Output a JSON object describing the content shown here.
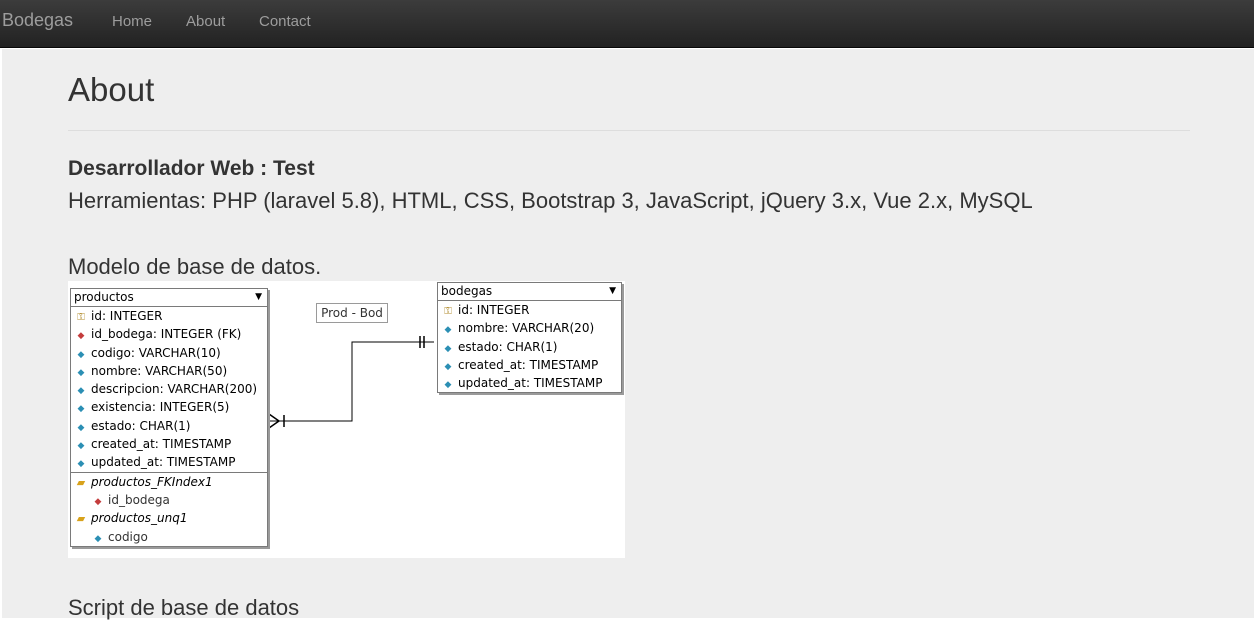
{
  "navbar": {
    "brand": "Bodegas",
    "links": [
      "Home",
      "About",
      "Contact"
    ]
  },
  "page": {
    "title": "About",
    "developer": "Desarrollador Web : Test",
    "tools": "Herramientas: PHP (laravel 5.8), HTML, CSS, Bootstrap 3, JavaScript, jQuery 3.x, Vue 2.x, MySQL",
    "model_heading": "Modelo de base de datos.",
    "script_heading": "Script de base de datos"
  },
  "diagram": {
    "productos": {
      "name": "productos",
      "columns": [
        "id: INTEGER",
        "id_bodega: INTEGER (FK)",
        "codigo: VARCHAR(10)",
        "nombre: VARCHAR(50)",
        "descripcion: VARCHAR(200)",
        "existencia: INTEGER(5)",
        "estado: CHAR(1)",
        "created_at: TIMESTAMP",
        "updated_at: TIMESTAMP"
      ],
      "indexes": [
        {
          "name": "productos_FKIndex1",
          "column": "id_bodega"
        },
        {
          "name": "productos_unq1",
          "column": "codigo"
        }
      ]
    },
    "bodegas": {
      "name": "bodegas",
      "columns": [
        "id: INTEGER",
        "nombre: VARCHAR(20)",
        "estado: CHAR(1)",
        "created_at: TIMESTAMP",
        "updated_at: TIMESTAMP"
      ]
    },
    "relation_label": "Prod - Bod"
  },
  "colors": {
    "navbar": "#222222",
    "nav_text": "#9d9d9d",
    "page_bg": "#eeeeee",
    "key_icon": "#b08a2a",
    "column_icon": "#2b8fb4",
    "fk_icon": "#c43c3c",
    "index_icon": "#d8a21b"
  }
}
